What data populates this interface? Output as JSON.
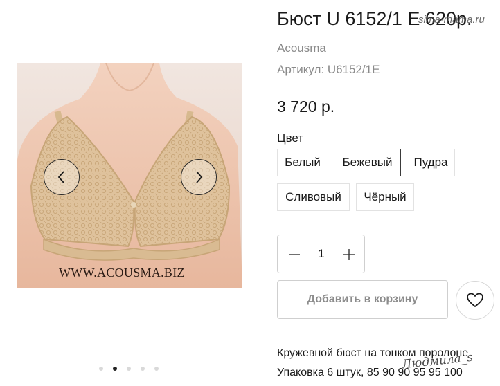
{
  "product": {
    "title": "Бюст U 6152/1 Е 620р.",
    "site_stamp": "sima-mama.ru",
    "brand": "Acousma",
    "sku": "Артикул: U6152/1E",
    "price": "3 720 р."
  },
  "gallery": {
    "watermark": "WWW.ACOUSMA.BIZ",
    "prev_icon": "chevron-left-icon",
    "next_icon": "chevron-right-icon",
    "slide_count": 5,
    "active_slide": 2
  },
  "colors": {
    "label": "Цвет",
    "options": [
      "Белый",
      "Бежевый",
      "Пудра",
      "Сливовый",
      "Чёрный"
    ],
    "selected": "Бежевый"
  },
  "quantity": {
    "value": "1",
    "minus_icon": "minus-icon",
    "plus_icon": "plus-icon"
  },
  "actions": {
    "add_to_cart": "Добавить в корзину",
    "favorite_icon": "heart-icon"
  },
  "description": {
    "line1": "Кружевной бюст на тонком поролоне.",
    "line2": "Упаковка 6 штук, 85 90 90 95 95 100",
    "signature": "Людмила_s"
  },
  "theme": {
    "border": "#cfcfcf",
    "text": "#1a1a1a",
    "muted": "#8a8a8a"
  }
}
